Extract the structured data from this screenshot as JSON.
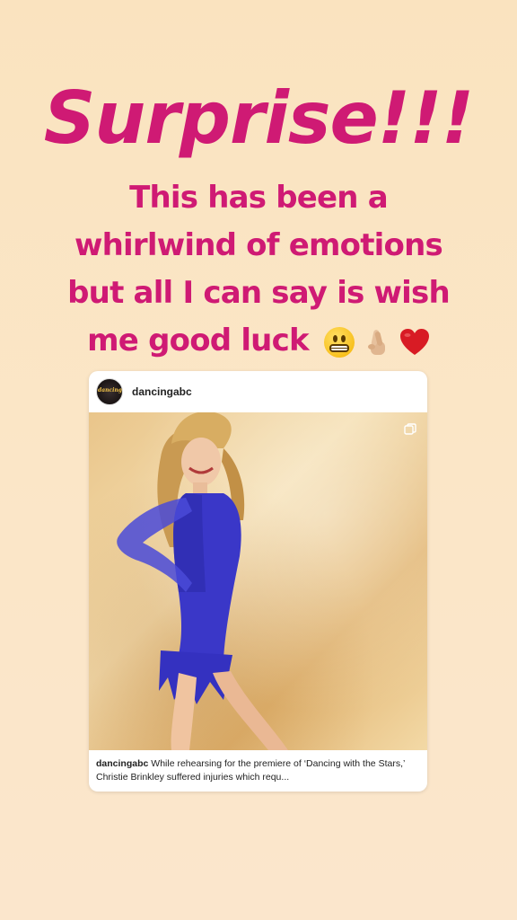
{
  "story": {
    "headline": "Surprise!!!",
    "message_lines": [
      "This has been a",
      "whirlwind of emotions",
      "but all I can say is wish",
      "me good luck"
    ],
    "emojis": [
      "grimacing-face-icon",
      "crossed-fingers-icon",
      "red-heart-icon"
    ],
    "colors": {
      "text": "#cf1a74",
      "background": "#fae3bf"
    }
  },
  "post": {
    "username": "dancingabc",
    "caption_username": "dancingabc",
    "caption_text": "While rehearsing for the premiere of ‘Dancing with the Stars,’ Christie Brinkley suffered injuries which requ..."
  }
}
